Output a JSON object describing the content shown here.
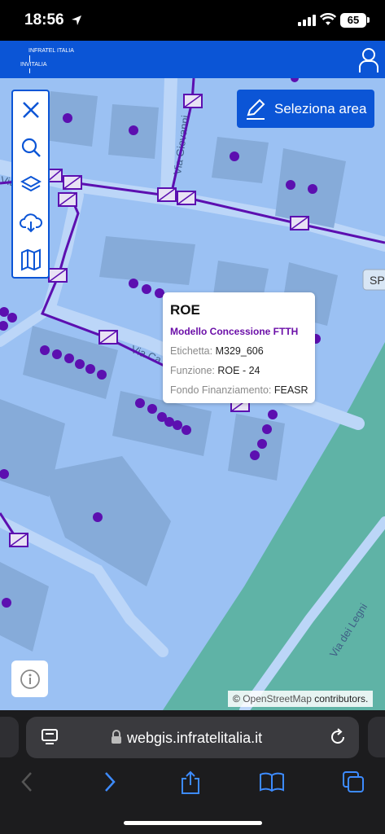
{
  "status_bar": {
    "time": "18:56",
    "battery": "65"
  },
  "header": {
    "logo_top": "INFRATEL ITALIA",
    "logo_bottom": "INVITALIA"
  },
  "map": {
    "street_labels": [
      "Via Giovanni",
      "Via",
      "Via Ca",
      "SP",
      "Via dei Legni"
    ],
    "select_area_label": "Seleziona area",
    "attribution_symbol": "©",
    "attribution_link": "OpenStreetMap",
    "attribution_suffix": "contributors."
  },
  "popup": {
    "title": "ROE",
    "subtitle": "Modello Concessione FTTH",
    "rows": [
      {
        "key": "Etichetta:",
        "value": "M329_606"
      },
      {
        "key": "Funzione:",
        "value": "ROE - 24"
      },
      {
        "key": "Fondo Finanziamento:",
        "value": "FEASR"
      }
    ]
  },
  "browser": {
    "url": "webgis.infratelitalia.it"
  },
  "colors": {
    "header_blue": "#0b55d6",
    "fiber_purple": "#5c0fb0",
    "map_blue": "#9bc1f3",
    "park_green": "#5fb3a6"
  }
}
